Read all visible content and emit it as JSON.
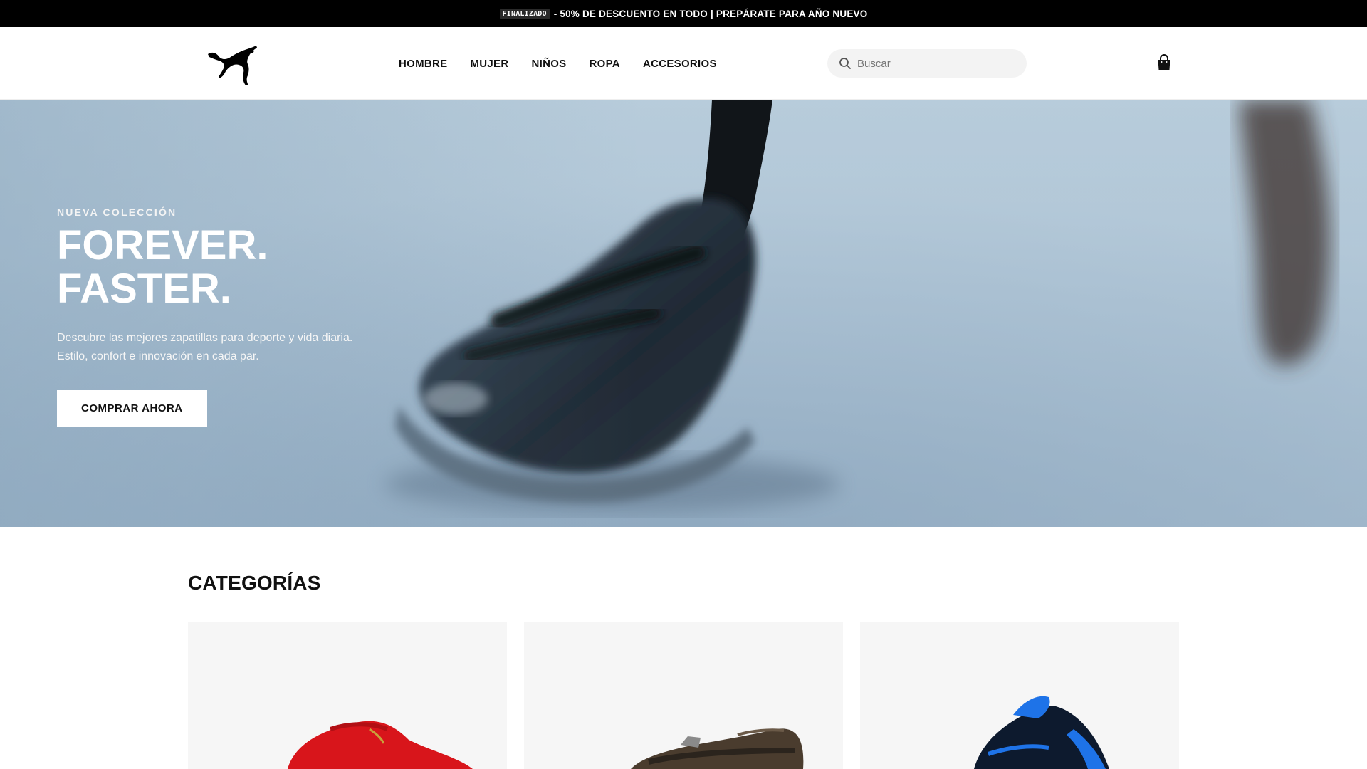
{
  "promo": {
    "tag": "FINALIZADO",
    "text": "- 50% DE DESCUENTO EN TODO | PREPÁRATE PARA AÑO NUEVO"
  },
  "header": {
    "logo_icon": "puma-logo-icon",
    "nav": [
      {
        "label": "HOMBRE"
      },
      {
        "label": "MUJER"
      },
      {
        "label": "NIÑOS"
      },
      {
        "label": "ROPA"
      },
      {
        "label": "ACCESORIOS"
      }
    ],
    "search": {
      "placeholder": "Buscar",
      "value": "",
      "icon": "search-icon"
    },
    "cart_icon": "shopping-bag-icon"
  },
  "hero": {
    "eyebrow": "NUEVA COLECCIÓN",
    "title_line1": "FOREVER.",
    "title_line2": "FASTER.",
    "description": "Descubre las mejores zapatillas para deporte y vida diaria. Estilo, confort e innovación en cada par.",
    "cta_label": "COMPRAR AHORA"
  },
  "categories": {
    "title": "CATEGORÍAS",
    "cards": [
      {
        "image": "red-sneaker"
      },
      {
        "image": "mary-jane-shoe"
      },
      {
        "image": "blue-sneaker"
      }
    ]
  },
  "colors": {
    "promo_bg": "#000000",
    "hero_sky": "#a9c0d3",
    "card_bg": "#f6f6f6"
  }
}
